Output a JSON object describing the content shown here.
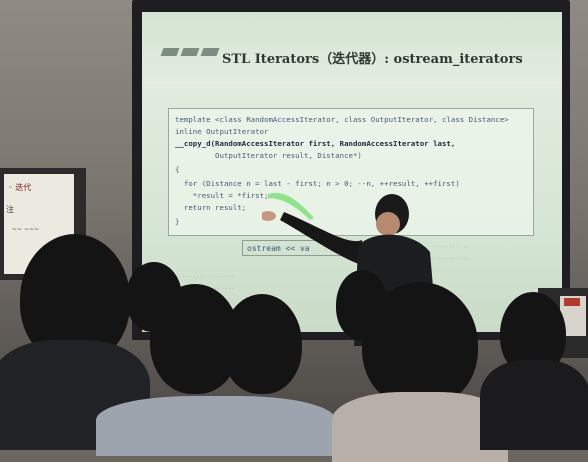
{
  "slide": {
    "title": "STL Iterators（迭代器）: ostream_iterators",
    "code_lines": [
      "template <class RandomAccessIterator, class OutputIterator, class Distance>",
      "inline OutputIterator",
      "__copy_d(RandomAccessIterator first, RandomAccessIterator last,",
      "         OutputIterator result, Distance*)",
      "{",
      "  for (Distance n = last - first; n > 0; --n, ++result, ++first)",
      "    *result = *first;",
      "  return result;",
      "}"
    ],
    "highlight_text": "ostream << va"
  },
  "colors": {
    "slide_bg": "#dbe9d8",
    "code_text": "#4a5a74",
    "laser": "#7ee07a"
  }
}
